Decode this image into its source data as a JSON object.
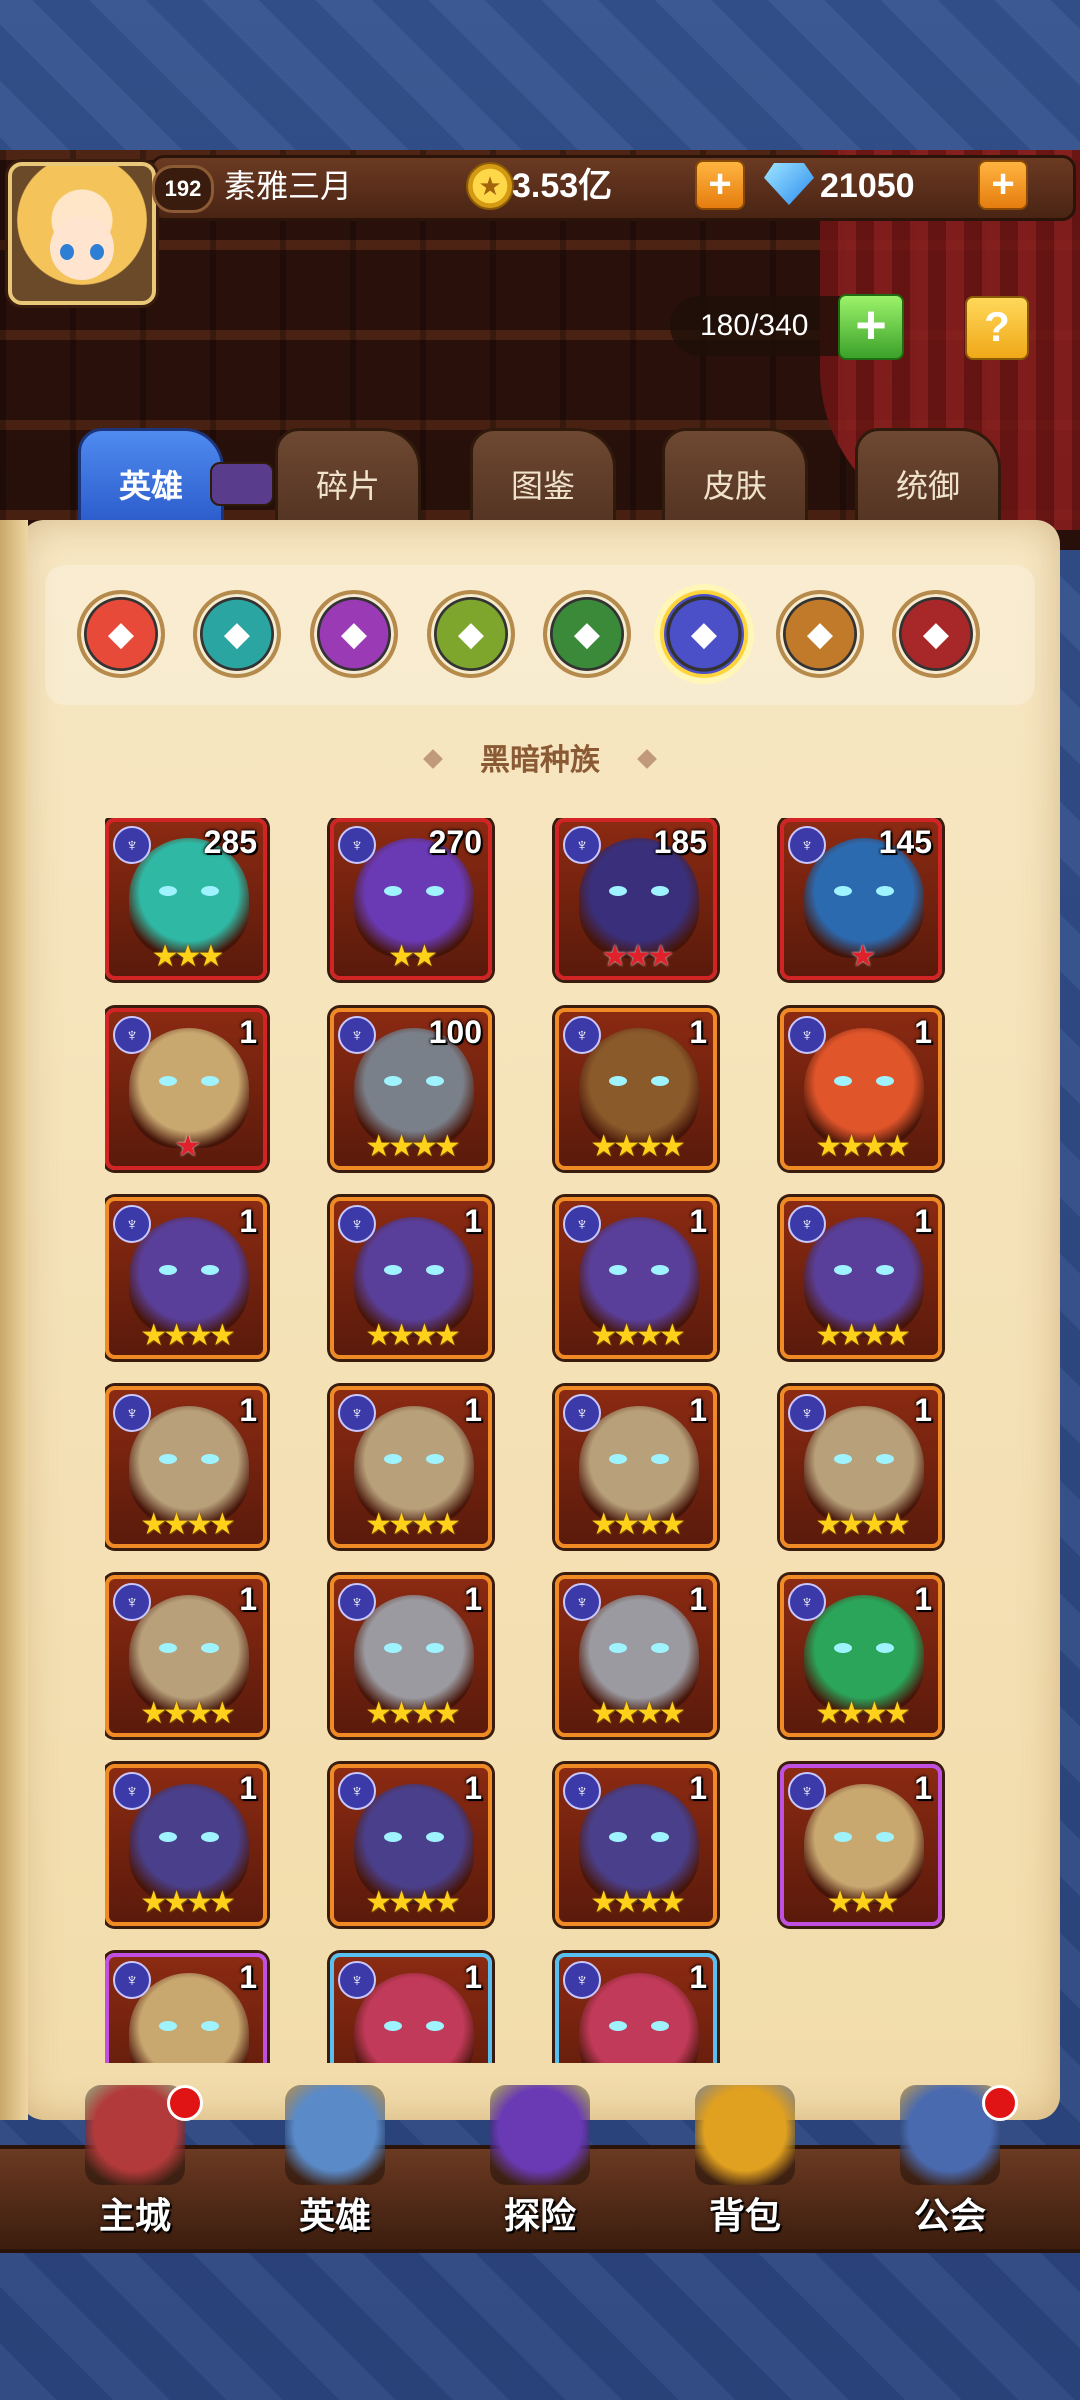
{
  "header": {
    "player_level": "192",
    "player_name": "素雅三月",
    "coins": "3.53亿",
    "gems": "21050",
    "hero_capacity": "180/340",
    "help_label": "?"
  },
  "tabs": [
    {
      "label": "英雄",
      "active": true
    },
    {
      "label": "碎片",
      "active": false
    },
    {
      "label": "图鉴",
      "active": false
    },
    {
      "label": "皮肤",
      "active": false
    },
    {
      "label": "统御",
      "active": false
    }
  ],
  "races": [
    {
      "icon": "all-races-icon",
      "color": "#e84a3a"
    },
    {
      "icon": "fortress-icon",
      "color": "#2ba5a2"
    },
    {
      "icon": "abyss-icon",
      "color": "#9a3bb5"
    },
    {
      "icon": "forest-icon",
      "color": "#7ea62c"
    },
    {
      "icon": "shadow-icon",
      "color": "#3a8a3a"
    },
    {
      "icon": "dark-race-icon",
      "color": "#4b4fc8",
      "active": true
    },
    {
      "icon": "light-icon",
      "color": "#c07a2a"
    },
    {
      "icon": "dark-icon",
      "color": "#a8282a"
    }
  ],
  "section_title": "黑暗种族",
  "heroes": [
    {
      "level": "285",
      "stars": "★★★",
      "rarity": "red",
      "tint": "#2fb9a5"
    },
    {
      "level": "270",
      "stars": "★★",
      "rarity": "red",
      "tint": "#6a3ab4"
    },
    {
      "level": "185",
      "stars": "★★★",
      "rarity": "red",
      "tint": "#3a2f7a",
      "star_type": "red"
    },
    {
      "level": "145",
      "stars": "★",
      "rarity": "red",
      "tint": "#2c6ab0",
      "star_type": "red"
    },
    {
      "level": "1",
      "stars": "★",
      "rarity": "red",
      "tint": "#c9a870",
      "star_type": "red"
    },
    {
      "level": "100",
      "stars": "★★★★",
      "rarity": "orange",
      "tint": "#7a808a"
    },
    {
      "level": "1",
      "stars": "★★★★",
      "rarity": "orange",
      "tint": "#8a5a2a"
    },
    {
      "level": "1",
      "stars": "★★★★",
      "rarity": "orange",
      "tint": "#e0552a"
    },
    {
      "level": "1",
      "stars": "★★★★",
      "rarity": "orange",
      "tint": "#5a3f9a"
    },
    {
      "level": "1",
      "stars": "★★★★",
      "rarity": "orange",
      "tint": "#5a3f9a"
    },
    {
      "level": "1",
      "stars": "★★★★",
      "rarity": "orange",
      "tint": "#5a3f9a"
    },
    {
      "level": "1",
      "stars": "★★★★",
      "rarity": "orange",
      "tint": "#5a3f9a"
    },
    {
      "level": "1",
      "stars": "★★★★",
      "rarity": "orange",
      "tint": "#b7a07a"
    },
    {
      "level": "1",
      "stars": "★★★★",
      "rarity": "orange",
      "tint": "#b7a07a"
    },
    {
      "level": "1",
      "stars": "★★★★",
      "rarity": "orange",
      "tint": "#b7a07a"
    },
    {
      "level": "1",
      "stars": "★★★★",
      "rarity": "orange",
      "tint": "#b7a07a"
    },
    {
      "level": "1",
      "stars": "★★★★",
      "rarity": "orange",
      "tint": "#b7a07a"
    },
    {
      "level": "1",
      "stars": "★★★★",
      "rarity": "orange",
      "tint": "#9a9aa0"
    },
    {
      "level": "1",
      "stars": "★★★★",
      "rarity": "orange",
      "tint": "#9a9aa0"
    },
    {
      "level": "1",
      "stars": "★★★★",
      "rarity": "orange",
      "tint": "#2aa55a"
    },
    {
      "level": "1",
      "stars": "★★★★",
      "rarity": "orange",
      "tint": "#4a3f8a"
    },
    {
      "level": "1",
      "stars": "★★★★",
      "rarity": "orange",
      "tint": "#4a3f8a"
    },
    {
      "level": "1",
      "stars": "★★★★",
      "rarity": "orange",
      "tint": "#4a3f8a"
    },
    {
      "level": "1",
      "stars": "★★★",
      "rarity": "purple",
      "tint": "#c9a870"
    },
    {
      "level": "1",
      "stars": "",
      "rarity": "purple",
      "tint": "#c9a870"
    },
    {
      "level": "1",
      "stars": "",
      "rarity": "blue",
      "tint": "#c23a5a"
    },
    {
      "level": "1",
      "stars": "",
      "rarity": "blue",
      "tint": "#c23a5a"
    }
  ],
  "bottom_nav": [
    {
      "label": "主城",
      "icon": "castle-icon",
      "badge": true
    },
    {
      "label": "英雄",
      "icon": "hero-icon",
      "badge": false
    },
    {
      "label": "探险",
      "icon": "portal-icon",
      "badge": false
    },
    {
      "label": "背包",
      "icon": "backpack-icon",
      "badge": false
    },
    {
      "label": "公会",
      "icon": "guild-icon",
      "badge": true
    }
  ]
}
